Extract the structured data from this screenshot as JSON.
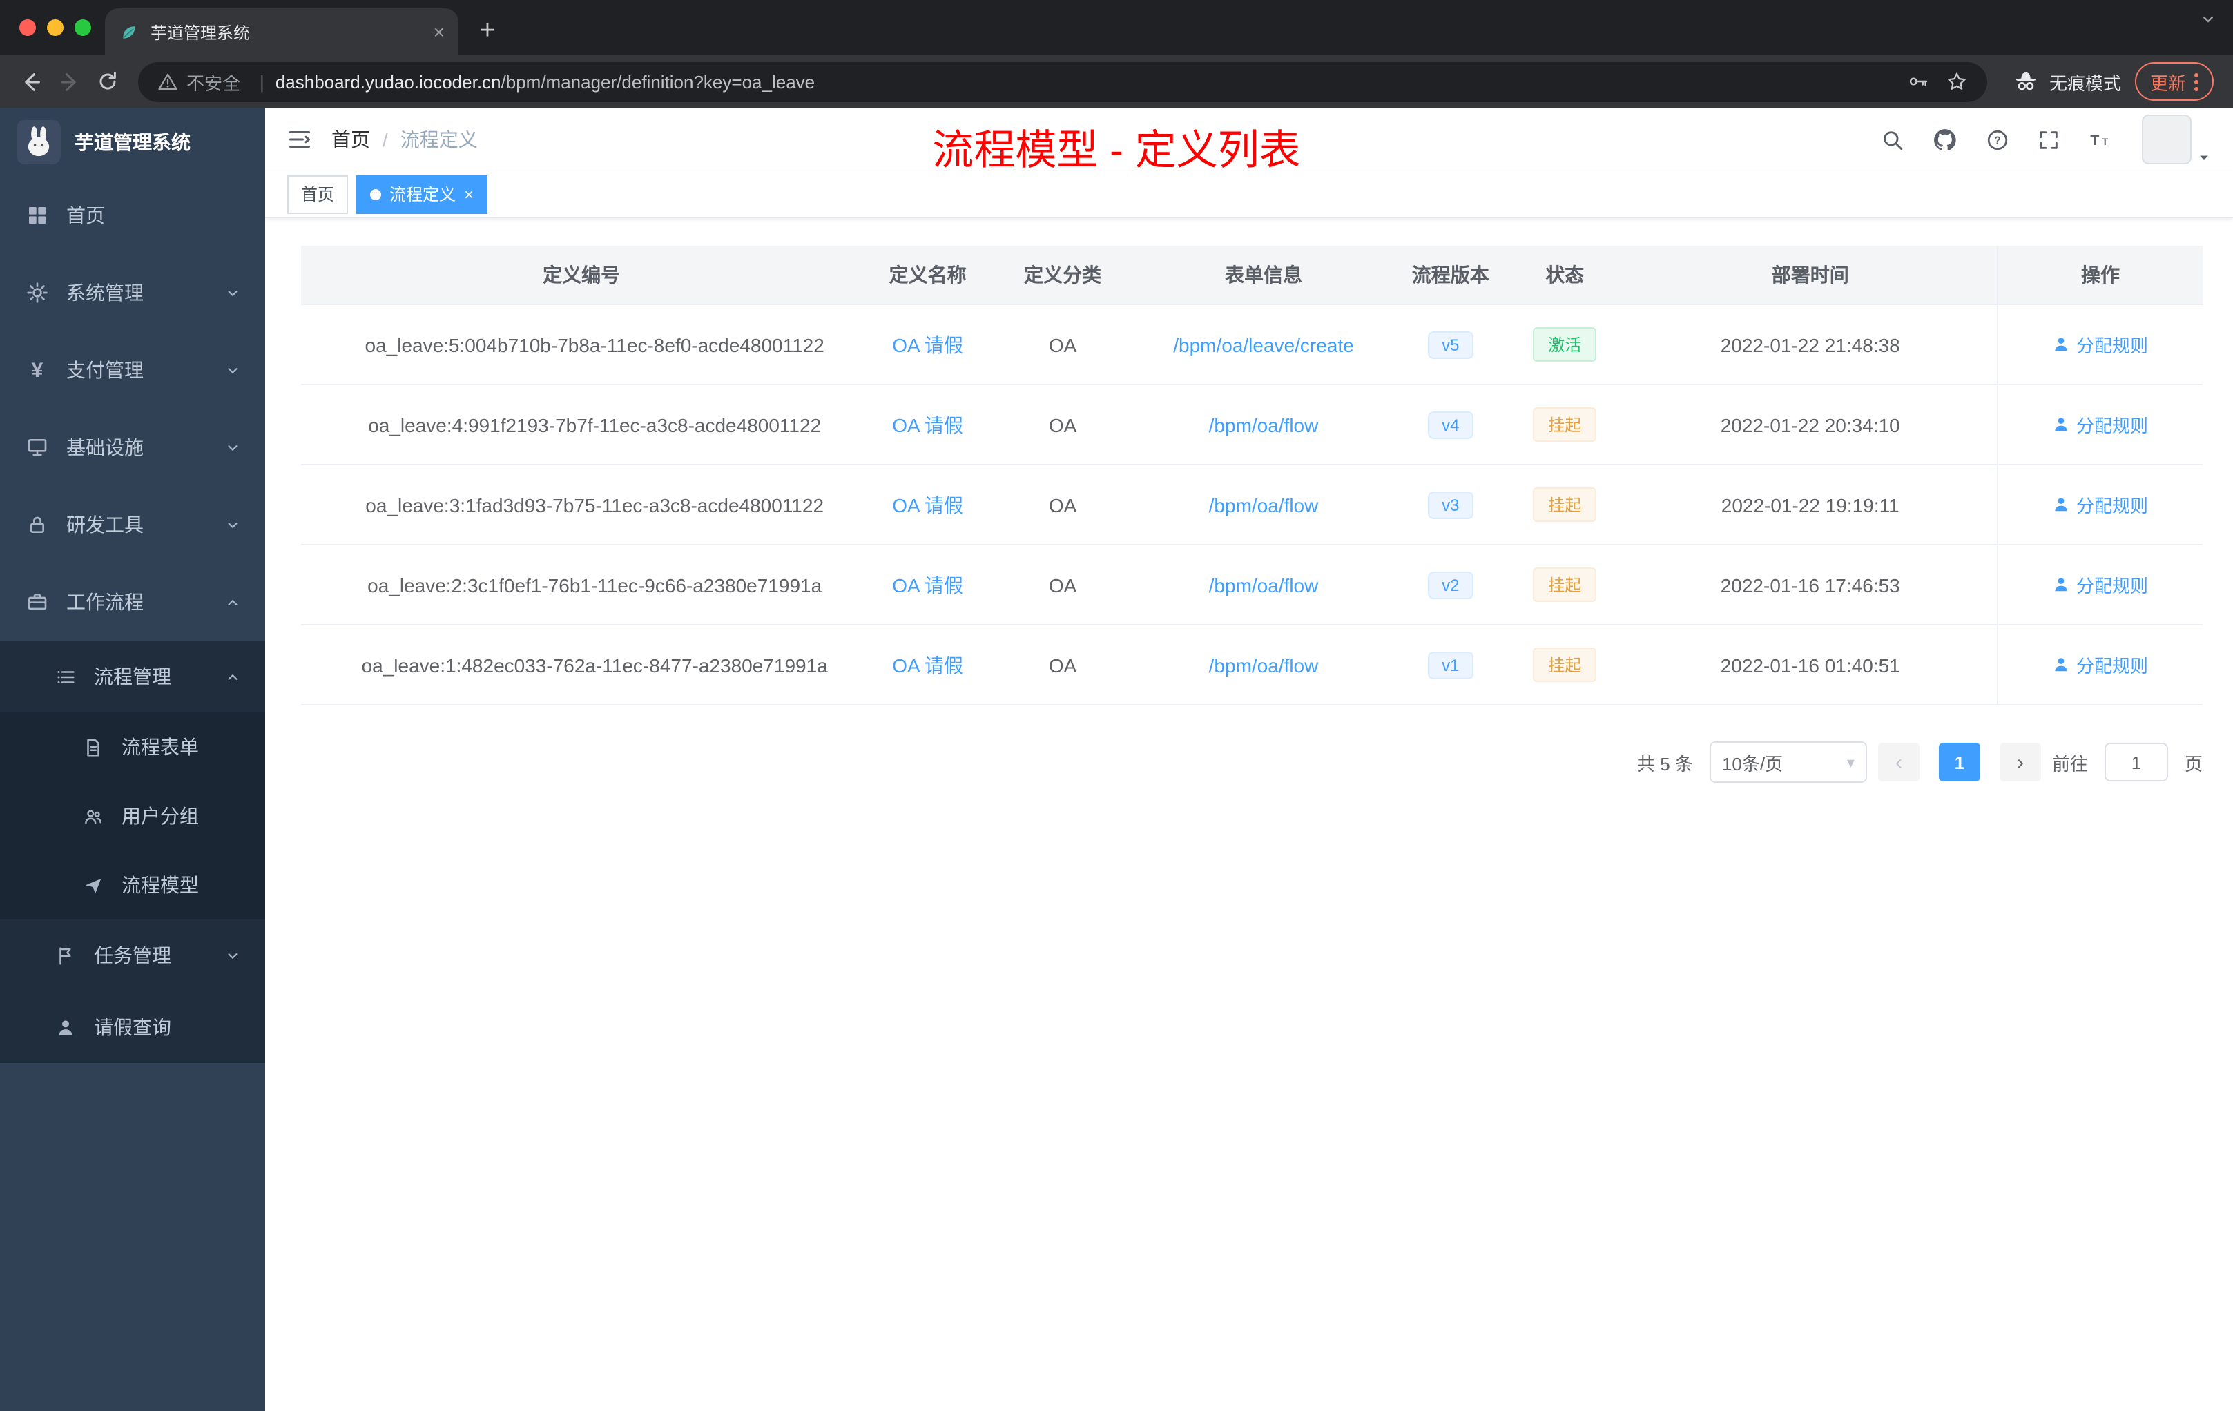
{
  "browser": {
    "tab_title": "芋道管理系统",
    "security": "不安全",
    "url_host": "dashboard.yudao.iocoder.cn",
    "url_path": "/bpm/manager/definition?key=oa_leave",
    "incognito": "无痕模式",
    "update": "更新"
  },
  "sidebar": {
    "logo_title": "芋道管理系统",
    "items": {
      "home": "首页",
      "system": "系统管理",
      "payment": "支付管理",
      "infra": "基础设施",
      "devtools": "研发工具",
      "workflow": "工作流程",
      "process_mgmt": "流程管理",
      "process_form": "流程表单",
      "user_group": "用户分组",
      "process_model": "流程模型",
      "task_mgmt": "任务管理",
      "leave_query": "请假查询"
    }
  },
  "header": {
    "breadcrumb_home": "首页",
    "breadcrumb_sep": "/",
    "breadcrumb_current": "流程定义",
    "annotation": "流程模型 - 定义列表"
  },
  "tags": {
    "home": "首页",
    "current": "流程定义",
    "close": "×"
  },
  "table": {
    "columns": [
      "定义编号",
      "定义名称",
      "定义分类",
      "表单信息",
      "流程版本",
      "状态",
      "部署时间",
      "操作"
    ],
    "rows": [
      {
        "id": "oa_leave:5:004b710b-7b8a-11ec-8ef0-acde48001122",
        "name": "OA 请假",
        "category": "OA",
        "form": "/bpm/oa/leave/create",
        "version": "v5",
        "status": "激活",
        "status_type": "success",
        "time": "2022-01-22 21:48:38",
        "action": "分配规则"
      },
      {
        "id": "oa_leave:4:991f2193-7b7f-11ec-a3c8-acde48001122",
        "name": "OA 请假",
        "category": "OA",
        "form": "/bpm/oa/flow",
        "version": "v4",
        "status": "挂起",
        "status_type": "warning",
        "time": "2022-01-22 20:34:10",
        "action": "分配规则"
      },
      {
        "id": "oa_leave:3:1fad3d93-7b75-11ec-a3c8-acde48001122",
        "name": "OA 请假",
        "category": "OA",
        "form": "/bpm/oa/flow",
        "version": "v3",
        "status": "挂起",
        "status_type": "warning",
        "time": "2022-01-22 19:19:11",
        "action": "分配规则"
      },
      {
        "id": "oa_leave:2:3c1f0ef1-76b1-11ec-9c66-a2380e71991a",
        "name": "OA 请假",
        "category": "OA",
        "form": "/bpm/oa/flow",
        "version": "v2",
        "status": "挂起",
        "status_type": "warning",
        "time": "2022-01-16 17:46:53",
        "action": "分配规则"
      },
      {
        "id": "oa_leave:1:482ec033-762a-11ec-8477-a2380e71991a",
        "name": "OA 请假",
        "category": "OA",
        "form": "/bpm/oa/flow",
        "version": "v1",
        "status": "挂起",
        "status_type": "warning",
        "time": "2022-01-16 01:40:51",
        "action": "分配规则"
      }
    ]
  },
  "pagination": {
    "total": "共 5 条",
    "size": "10条/页",
    "prev": "‹",
    "next": "›",
    "page": "1",
    "goto": "前往",
    "goto_value": "1",
    "unit": "页"
  },
  "colors": {
    "accent": "#409eff",
    "success": "#1fbf6c",
    "warning": "#e6a23c",
    "annotation": "#ff0000",
    "sidebar_bg": "#304156",
    "submenu_bg": "#1f2d3d"
  }
}
